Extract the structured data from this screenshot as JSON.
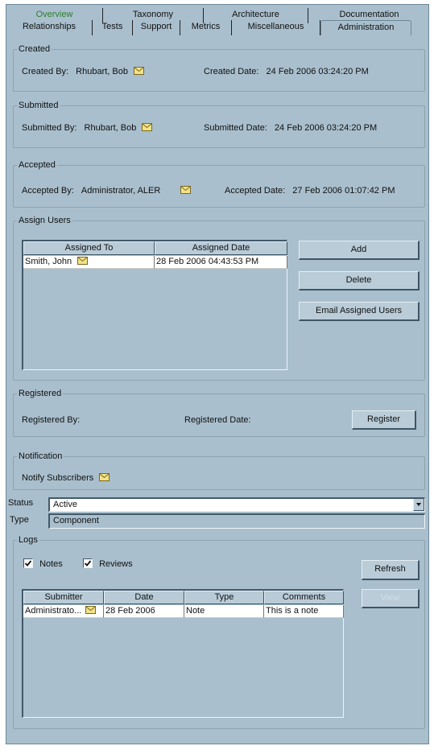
{
  "tabs_back": [
    "Overview",
    "Taxonomy",
    "Architecture",
    "Documentation"
  ],
  "tabs_front": [
    "Relationships",
    "Tests",
    "Support",
    "Metrics",
    "Miscellaneous",
    "Administration"
  ],
  "created": {
    "legend": "Created",
    "by_label": "Created By:",
    "by_value": "Rhubart, Bob",
    "date_label": "Created Date:",
    "date_value": "24 Feb 2006 03:24:20 PM"
  },
  "submitted": {
    "legend": "Submitted",
    "by_label": "Submitted By:",
    "by_value": "Rhubart, Bob",
    "date_label": "Submitted Date:",
    "date_value": "24 Feb 2006 03:24:20 PM"
  },
  "accepted": {
    "legend": "Accepted",
    "by_label": "Accepted By:",
    "by_value": "Administrator, ALER",
    "date_label": "Accepted Date:",
    "date_value": "27 Feb 2006 01:07:42 PM"
  },
  "assign_users": {
    "legend": "Assign Users",
    "columns": [
      "Assigned To",
      "Assigned Date"
    ],
    "rows": [
      {
        "assigned_to": "Smith, John",
        "assigned_date": "28 Feb 2006 04:43:53 PM"
      }
    ],
    "add_label": "Add",
    "delete_label": "Delete",
    "email_label": "Email Assigned Users"
  },
  "registered": {
    "legend": "Registered",
    "by_label": "Registered By:",
    "date_label": "Registered Date:",
    "register_label": "Register"
  },
  "notification": {
    "legend": "Notification",
    "notify_label": "Notify Subscribers"
  },
  "status": {
    "label": "Status",
    "value": "Active"
  },
  "type": {
    "label": "Type",
    "value": "Component"
  },
  "logs": {
    "legend": "Logs",
    "notes_label": "Notes",
    "notes_checked": true,
    "reviews_label": "Reviews",
    "reviews_checked": true,
    "refresh_label": "Refresh",
    "view_label": "View",
    "columns": [
      "Submitter",
      "Date",
      "Type",
      "Comments"
    ],
    "rows": [
      {
        "submitter": "Administrato...",
        "date": "28 Feb 2006",
        "type": "Note",
        "comments": "This is a note"
      }
    ]
  },
  "colors": {
    "panel": "#a9bfcd",
    "overview_tab": "#2e7d2e"
  },
  "icons": {
    "mail": "envelope-icon",
    "dropdown": "chevron-down-icon",
    "check": "checkmark-icon"
  }
}
